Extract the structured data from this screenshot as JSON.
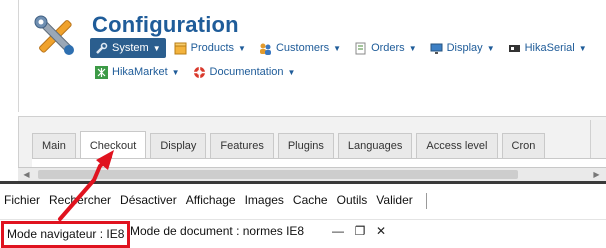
{
  "header": {
    "title": "Configuration",
    "menu_row1": [
      {
        "label": "System",
        "icon": "wrench-icon",
        "active": true
      },
      {
        "label": "Products",
        "icon": "box-icon"
      },
      {
        "label": "Customers",
        "icon": "users-icon"
      },
      {
        "label": "Orders",
        "icon": "order-icon"
      },
      {
        "label": "Display",
        "icon": "monitor-icon"
      },
      {
        "label": "HikaSerial",
        "icon": "serial-icon"
      }
    ],
    "menu_row2": [
      {
        "label": "HikaMarket",
        "icon": "market-icon"
      },
      {
        "label": "Documentation",
        "icon": "lifebuoy-icon"
      }
    ],
    "caret": "▼"
  },
  "tabs": [
    {
      "label": "Main"
    },
    {
      "label": "Checkout",
      "active": true
    },
    {
      "label": "Display"
    },
    {
      "label": "Features"
    },
    {
      "label": "Plugins"
    },
    {
      "label": "Languages"
    },
    {
      "label": "Access level"
    },
    {
      "label": "Cron"
    }
  ],
  "devtools": {
    "menu": [
      "Fichier",
      "Rechercher",
      "Désactiver",
      "Affichage",
      "Images",
      "Cache",
      "Outils",
      "Valider"
    ],
    "browser_mode": "Mode navigateur : IE8",
    "document_mode": "Mode de document :  normes IE8",
    "window_controls": {
      "minimize": "—",
      "restore": "❐",
      "close": "✕"
    }
  },
  "colors": {
    "accent": "#1f5c99",
    "active_menu": "#2b5e8e",
    "highlight": "#e0131f"
  }
}
